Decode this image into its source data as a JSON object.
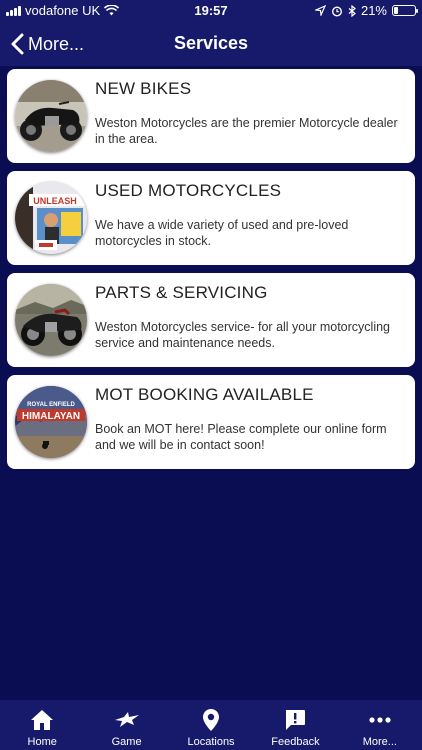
{
  "status_bar": {
    "carrier": "vodafone UK",
    "time": "19:57",
    "battery": "21%",
    "battery_level": 0.21
  },
  "nav": {
    "back_label": "More...",
    "title": "Services"
  },
  "services": [
    {
      "title": "NEW BIKES",
      "description": "Weston Motorcycles are the premier Motorcycle dealer in the area."
    },
    {
      "title": "USED MOTORCYCLES",
      "description": "We have a wide variety of used and pre-loved motorcycles in stock.",
      "image_text": "UNLEASH"
    },
    {
      "title": "PARTS & SERVICING",
      "description": "Weston Motorcycles service- for all your motorcycling service and maintenance needs."
    },
    {
      "title": "MOT BOOKING AVAILABLE",
      "description": "Book an MOT here! Please complete our online form and we will be in contact soon!",
      "image_text_1": "ROYAL ENFIELD",
      "image_text_2": "HIMALAYAN"
    }
  ],
  "tabs": [
    {
      "label": "Home",
      "icon": "home-icon"
    },
    {
      "label": "Game",
      "icon": "bird-icon"
    },
    {
      "label": "Locations",
      "icon": "location-pin-icon"
    },
    {
      "label": "Feedback",
      "icon": "feedback-icon"
    },
    {
      "label": "More...",
      "icon": "more-icon"
    }
  ],
  "colors": {
    "background": "#0b0d52",
    "bar": "#17196a",
    "card": "#ffffff"
  }
}
